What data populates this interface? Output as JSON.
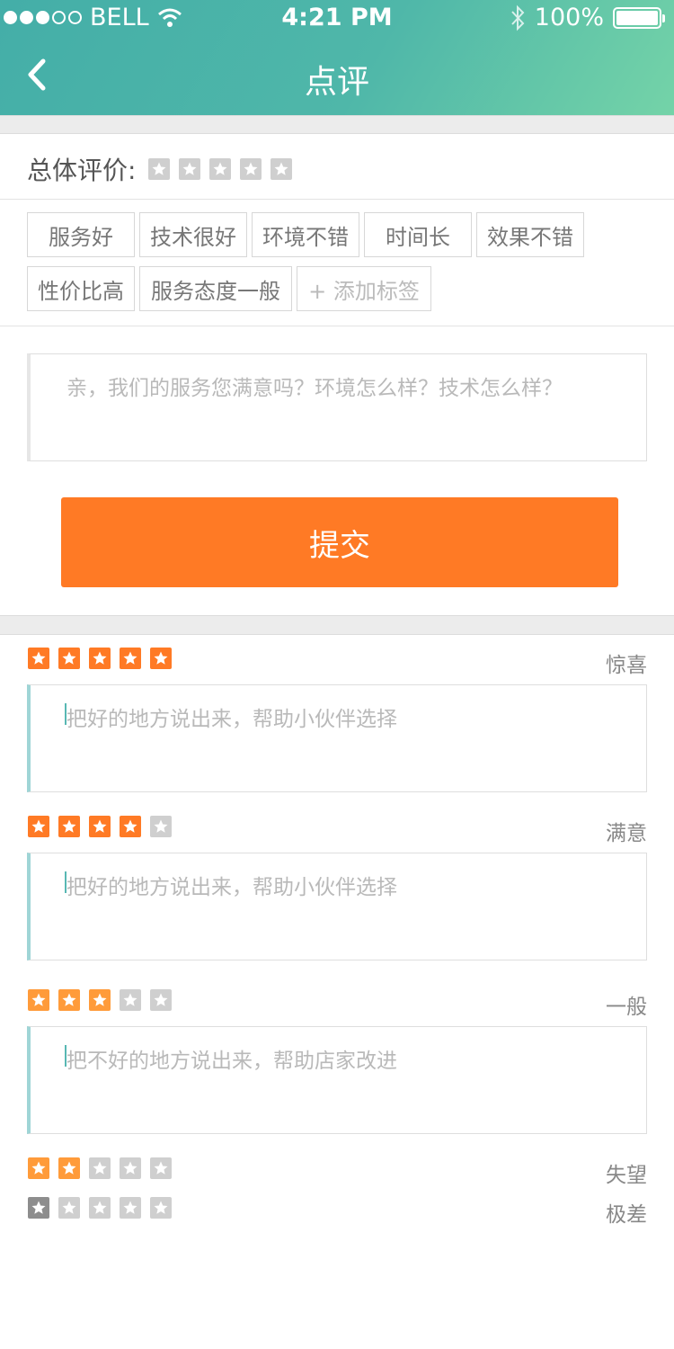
{
  "status_bar": {
    "carrier": "BELL",
    "time": "4:21 PM",
    "battery": "100%"
  },
  "nav": {
    "title": "点评"
  },
  "overall": {
    "label": "总体评价:",
    "rating": 0
  },
  "tags": {
    "row1": [
      "服务好",
      "技术很好",
      "环境不错",
      "时间长",
      "效果不错"
    ],
    "row2": [
      "性价比高",
      "服务态度一般"
    ],
    "add_label": "+ 添加标签"
  },
  "comment": {
    "placeholder": "亲，我们的服务您满意吗？环境怎么样？技术怎么样？"
  },
  "submit_label": "提交",
  "ratings": [
    {
      "stars": 5,
      "label": "惊喜",
      "placeholder": "把好的地方说出来，帮助小伙伴选择"
    },
    {
      "stars": 4,
      "label": "满意",
      "placeholder": "把好的地方说出来，帮助小伙伴选择"
    },
    {
      "stars": 3,
      "label": "一般",
      "placeholder": "把不好的地方说出来，帮助店家改进"
    },
    {
      "stars": 2,
      "label": "失望"
    },
    {
      "stars": 1,
      "label": "极差"
    }
  ],
  "colors": {
    "accent": "#ff7a25",
    "header_start": "#44aea8",
    "header_end": "#74d3a8"
  }
}
